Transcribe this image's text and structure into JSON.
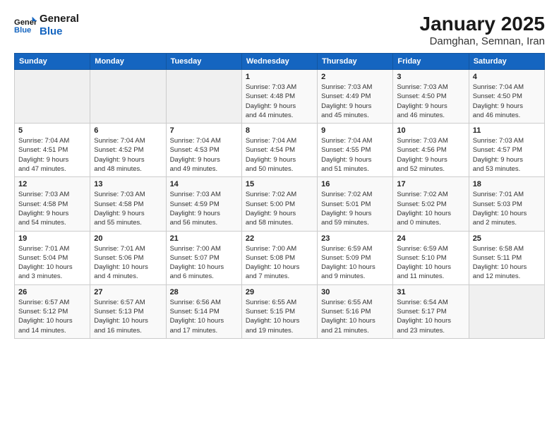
{
  "header": {
    "logo_line1": "General",
    "logo_line2": "Blue",
    "title": "January 2025",
    "subtitle": "Damghan, Semnan, Iran"
  },
  "weekdays": [
    "Sunday",
    "Monday",
    "Tuesday",
    "Wednesday",
    "Thursday",
    "Friday",
    "Saturday"
  ],
  "weeks": [
    [
      {
        "day": "",
        "info": ""
      },
      {
        "day": "",
        "info": ""
      },
      {
        "day": "",
        "info": ""
      },
      {
        "day": "1",
        "info": "Sunrise: 7:03 AM\nSunset: 4:48 PM\nDaylight: 9 hours\nand 44 minutes."
      },
      {
        "day": "2",
        "info": "Sunrise: 7:03 AM\nSunset: 4:49 PM\nDaylight: 9 hours\nand 45 minutes."
      },
      {
        "day": "3",
        "info": "Sunrise: 7:03 AM\nSunset: 4:50 PM\nDaylight: 9 hours\nand 46 minutes."
      },
      {
        "day": "4",
        "info": "Sunrise: 7:04 AM\nSunset: 4:50 PM\nDaylight: 9 hours\nand 46 minutes."
      }
    ],
    [
      {
        "day": "5",
        "info": "Sunrise: 7:04 AM\nSunset: 4:51 PM\nDaylight: 9 hours\nand 47 minutes."
      },
      {
        "day": "6",
        "info": "Sunrise: 7:04 AM\nSunset: 4:52 PM\nDaylight: 9 hours\nand 48 minutes."
      },
      {
        "day": "7",
        "info": "Sunrise: 7:04 AM\nSunset: 4:53 PM\nDaylight: 9 hours\nand 49 minutes."
      },
      {
        "day": "8",
        "info": "Sunrise: 7:04 AM\nSunset: 4:54 PM\nDaylight: 9 hours\nand 50 minutes."
      },
      {
        "day": "9",
        "info": "Sunrise: 7:04 AM\nSunset: 4:55 PM\nDaylight: 9 hours\nand 51 minutes."
      },
      {
        "day": "10",
        "info": "Sunrise: 7:03 AM\nSunset: 4:56 PM\nDaylight: 9 hours\nand 52 minutes."
      },
      {
        "day": "11",
        "info": "Sunrise: 7:03 AM\nSunset: 4:57 PM\nDaylight: 9 hours\nand 53 minutes."
      }
    ],
    [
      {
        "day": "12",
        "info": "Sunrise: 7:03 AM\nSunset: 4:58 PM\nDaylight: 9 hours\nand 54 minutes."
      },
      {
        "day": "13",
        "info": "Sunrise: 7:03 AM\nSunset: 4:58 PM\nDaylight: 9 hours\nand 55 minutes."
      },
      {
        "day": "14",
        "info": "Sunrise: 7:03 AM\nSunset: 4:59 PM\nDaylight: 9 hours\nand 56 minutes."
      },
      {
        "day": "15",
        "info": "Sunrise: 7:02 AM\nSunset: 5:00 PM\nDaylight: 9 hours\nand 58 minutes."
      },
      {
        "day": "16",
        "info": "Sunrise: 7:02 AM\nSunset: 5:01 PM\nDaylight: 9 hours\nand 59 minutes."
      },
      {
        "day": "17",
        "info": "Sunrise: 7:02 AM\nSunset: 5:02 PM\nDaylight: 10 hours\nand 0 minutes."
      },
      {
        "day": "18",
        "info": "Sunrise: 7:01 AM\nSunset: 5:03 PM\nDaylight: 10 hours\nand 2 minutes."
      }
    ],
    [
      {
        "day": "19",
        "info": "Sunrise: 7:01 AM\nSunset: 5:04 PM\nDaylight: 10 hours\nand 3 minutes."
      },
      {
        "day": "20",
        "info": "Sunrise: 7:01 AM\nSunset: 5:06 PM\nDaylight: 10 hours\nand 4 minutes."
      },
      {
        "day": "21",
        "info": "Sunrise: 7:00 AM\nSunset: 5:07 PM\nDaylight: 10 hours\nand 6 minutes."
      },
      {
        "day": "22",
        "info": "Sunrise: 7:00 AM\nSunset: 5:08 PM\nDaylight: 10 hours\nand 7 minutes."
      },
      {
        "day": "23",
        "info": "Sunrise: 6:59 AM\nSunset: 5:09 PM\nDaylight: 10 hours\nand 9 minutes."
      },
      {
        "day": "24",
        "info": "Sunrise: 6:59 AM\nSunset: 5:10 PM\nDaylight: 10 hours\nand 11 minutes."
      },
      {
        "day": "25",
        "info": "Sunrise: 6:58 AM\nSunset: 5:11 PM\nDaylight: 10 hours\nand 12 minutes."
      }
    ],
    [
      {
        "day": "26",
        "info": "Sunrise: 6:57 AM\nSunset: 5:12 PM\nDaylight: 10 hours\nand 14 minutes."
      },
      {
        "day": "27",
        "info": "Sunrise: 6:57 AM\nSunset: 5:13 PM\nDaylight: 10 hours\nand 16 minutes."
      },
      {
        "day": "28",
        "info": "Sunrise: 6:56 AM\nSunset: 5:14 PM\nDaylight: 10 hours\nand 17 minutes."
      },
      {
        "day": "29",
        "info": "Sunrise: 6:55 AM\nSunset: 5:15 PM\nDaylight: 10 hours\nand 19 minutes."
      },
      {
        "day": "30",
        "info": "Sunrise: 6:55 AM\nSunset: 5:16 PM\nDaylight: 10 hours\nand 21 minutes."
      },
      {
        "day": "31",
        "info": "Sunrise: 6:54 AM\nSunset: 5:17 PM\nDaylight: 10 hours\nand 23 minutes."
      },
      {
        "day": "",
        "info": ""
      }
    ]
  ]
}
